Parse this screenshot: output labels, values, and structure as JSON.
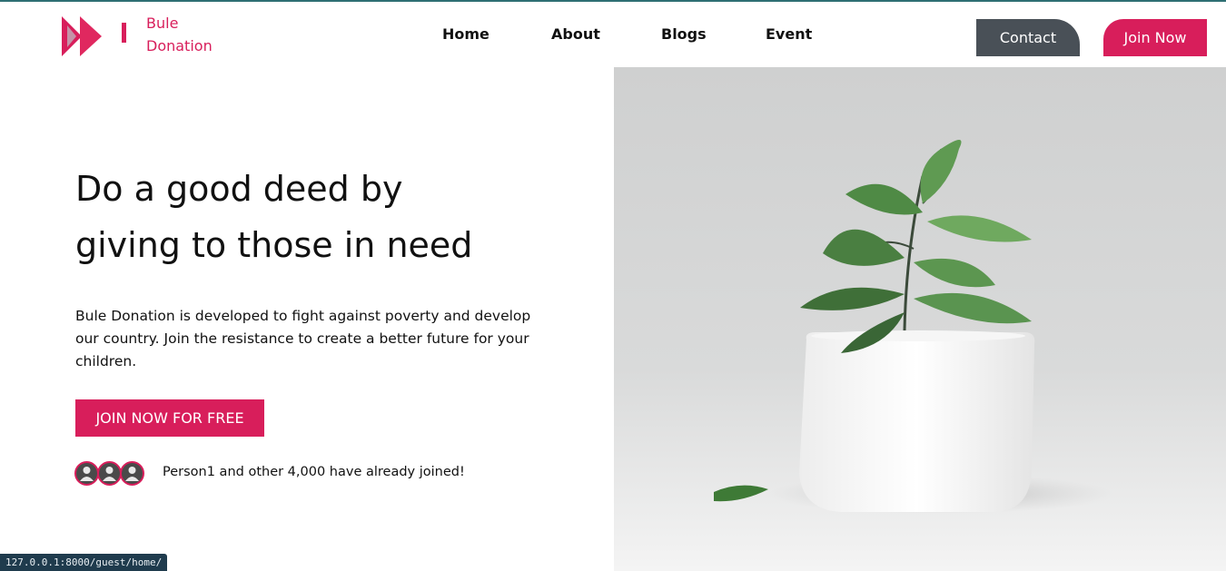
{
  "header": {
    "brand_line1": "Bule",
    "brand_line2": "Donation",
    "nav": [
      "Home",
      "About",
      "Blogs",
      "Event"
    ],
    "contact_label": "Contact",
    "join_label": "Join Now"
  },
  "hero": {
    "title_line1": "Do a good deed by",
    "title_line2": "giving to those in need",
    "description": "Bule Donation is developed to fight against poverty and develop our country. Join the resistance to create a better future for your children.",
    "cta_label": "JOIN NOW FOR FREE",
    "joined_text": "Person1 and other 4,000 have already joined!"
  },
  "image": {
    "icon": "plant-in-white-pot-image"
  },
  "status_bar": {
    "url": "127.0.0.1:8000/guest/home/"
  },
  "colors": {
    "accent": "#d81e5b",
    "contact_bg": "#495057",
    "status_bg": "#1f3b4d"
  }
}
